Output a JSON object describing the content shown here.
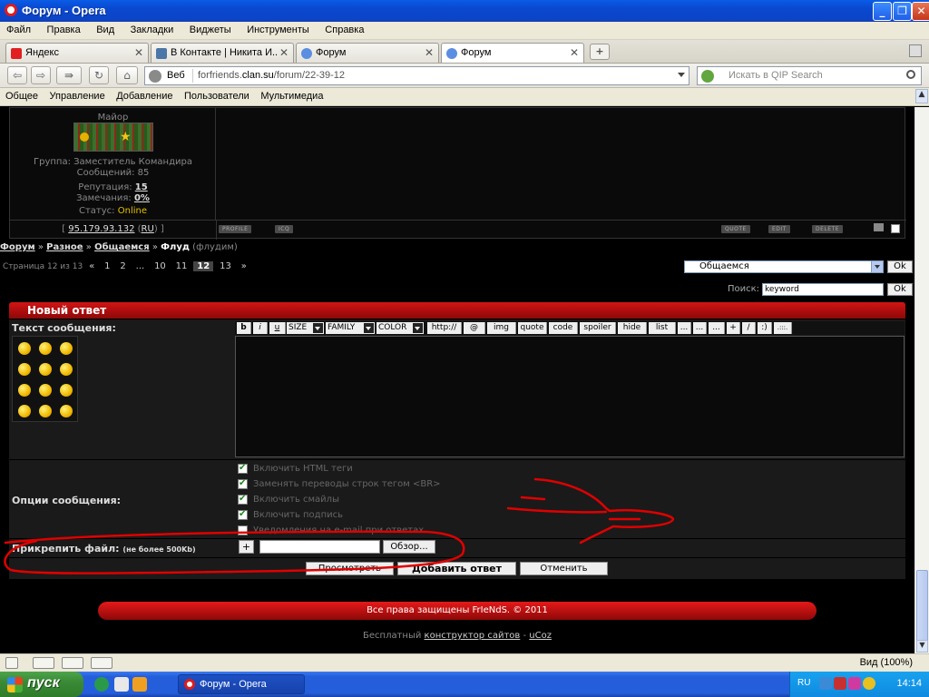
{
  "window": {
    "title": "Форум - Opera"
  },
  "menu": [
    "Файл",
    "Правка",
    "Вид",
    "Закладки",
    "Виджеты",
    "Инструменты",
    "Справка"
  ],
  "tabs": [
    {
      "label": "Яндекс",
      "color": "#e02020"
    },
    {
      "label": "В Контакте | Никита И...",
      "color": "#4a76a8"
    },
    {
      "label": "Форум",
      "color": "#5a8ee0"
    },
    {
      "label": "Форум",
      "color": "#5a8ee0"
    }
  ],
  "address": {
    "web_label": "Веб",
    "url_pre": "forfriends.",
    "url_domain": "clan.su",
    "url_post": "/forum/22-39-12",
    "search_placeholder": "Искать в QIP Search"
  },
  "personal_bar": [
    "Общее",
    "Управление",
    "Добавление",
    "Пользователи",
    "Мультимедиа"
  ],
  "post": {
    "rank": "Майор",
    "group_line": "Группа: Заместитель Командира",
    "messages_line": "Сообщений: 85",
    "reputation_label": "Репутация:",
    "reputation_value": "15",
    "warnings_label": "Замечания:",
    "warnings_value": "0%",
    "status_label": "Статус:",
    "status_value": "Online",
    "ip": "95.179.93.132",
    "ip_country": "RU",
    "buttons_left": [
      "PROFILE",
      "ICQ"
    ],
    "buttons_right": [
      "QUOTE",
      "EDIT",
      "DELETE"
    ]
  },
  "breadcrumb": {
    "items": [
      "Форум",
      "Разное",
      "Общаемся"
    ],
    "current": "Флуд",
    "extra": "(флудим)"
  },
  "pagination": {
    "label": "Страница 12 из 13",
    "prev": "«",
    "pages": [
      "1",
      "2",
      "...",
      "10",
      "11",
      "12",
      "13"
    ],
    "current": "12",
    "next": "»"
  },
  "forum_select": {
    "value": "Общаемся",
    "ok": "Ok"
  },
  "search": {
    "label": "Поиск:",
    "value": "keyword",
    "ok": "Ok"
  },
  "reply": {
    "header": "Новый ответ",
    "text_label": "Текст сообщения:",
    "toolbar": [
      "b",
      "i",
      "u",
      "http://",
      "@",
      "img",
      "quote",
      "code",
      "spoiler",
      "hide",
      "list",
      "...",
      "...",
      "...",
      "+",
      "/",
      ":)",
      ".:::."
    ],
    "selects": [
      "SIZE",
      "FAMILY",
      "COLOR"
    ],
    "options_label": "Опции сообщения:",
    "options": [
      {
        "label": "Включить HTML теги",
        "checked": true
      },
      {
        "label": "Заменять переводы строк тегом <BR>",
        "checked": true
      },
      {
        "label": "Включить смайлы",
        "checked": true
      },
      {
        "label": "Включить подпись",
        "checked": true
      },
      {
        "label": "Уведомления на e-mail при ответах",
        "checked": false
      }
    ],
    "attach_label": "Прикрепить файл:",
    "attach_note": "(не более 500Kb)",
    "plus": "+",
    "browse": "Обзор...",
    "preview": "Просмотреть",
    "submit": "Добавить ответ",
    "cancel": "Отменить"
  },
  "footer": {
    "copyright": "Все права защищены FrIeNdS. © 2011",
    "free_label": "Бесплатный",
    "constructor": "конструктор сайтов",
    "dash": "-",
    "ucoz": "uCoz"
  },
  "statusbar": {
    "zoom": "Вид (100%)"
  },
  "taskbar": {
    "start": "пуск",
    "task": "Форум - Opera",
    "lang": "RU",
    "time": "14:14"
  }
}
